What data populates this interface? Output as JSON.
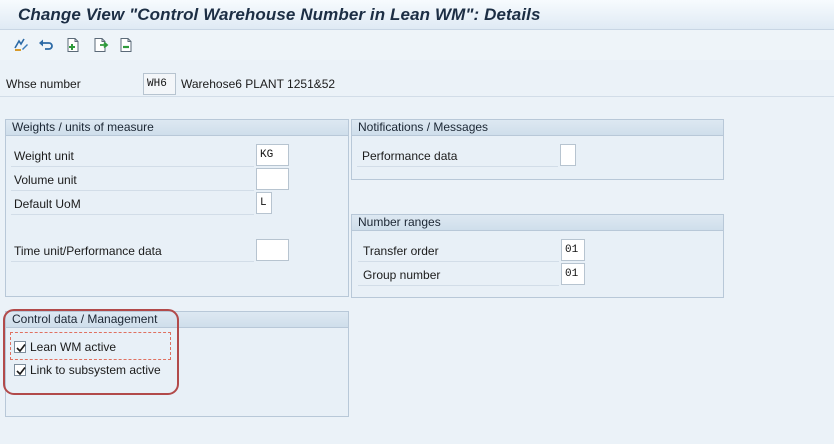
{
  "window": {
    "title": "Change View \"Control Warehouse Number in Lean WM\": Details"
  },
  "toolbar": {
    "buttons": [
      {
        "name": "display-change-icon"
      },
      {
        "name": "undo-icon"
      },
      {
        "name": "new-entries-icon"
      },
      {
        "name": "copy-icon"
      },
      {
        "name": "delete-icon"
      }
    ]
  },
  "header": {
    "whse_label": "Whse number",
    "whse_value": "WH6",
    "whse_description": "Warehose6 PLANT 1251&52"
  },
  "weights": {
    "title": "Weights / units of measure",
    "weight_unit_label": "Weight unit",
    "weight_unit_value": "KG",
    "volume_unit_label": "Volume unit",
    "volume_unit_value": "",
    "default_uom_label": "Default UoM",
    "default_uom_value": "L",
    "time_unit_label": "Time unit/Performance data",
    "time_unit_value": ""
  },
  "notifications": {
    "title": "Notifications / Messages",
    "performance_label": "Performance data",
    "performance_value": ""
  },
  "number_ranges": {
    "title": "Number ranges",
    "transfer_order_label": "Transfer order",
    "transfer_order_value": "01",
    "group_number_label": "Group number",
    "group_number_value": "01"
  },
  "control": {
    "title": "Control data / Management",
    "lean_wm_label": "Lean WM active",
    "lean_wm_checked": true,
    "link_subsystem_label": "Link to subsystem active",
    "link_subsystem_checked": true
  },
  "colors": {
    "background": "#ebf2f8",
    "group_header": "#cfdeeb",
    "highlight": "#b24a4a"
  }
}
